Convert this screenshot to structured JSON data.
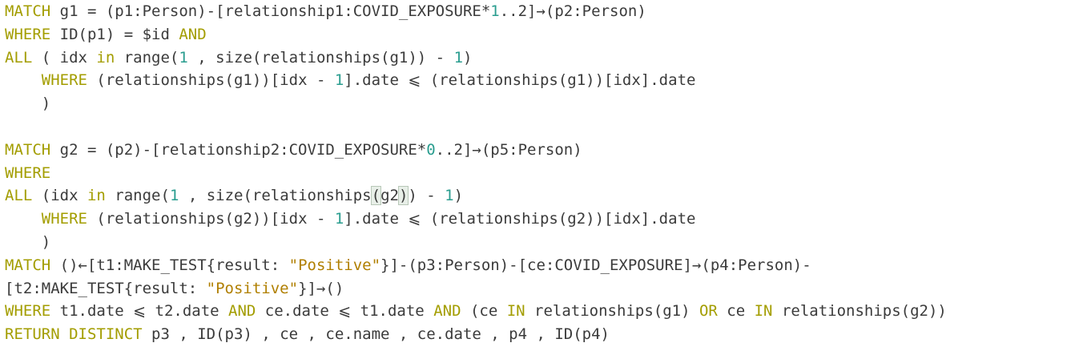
{
  "colors": {
    "background": "#ffffff",
    "text": "#3b3b3b",
    "keyword": "#a39d00",
    "number": "#2a9d8f",
    "string": "#b07f00"
  },
  "code": {
    "lines": [
      [
        {
          "t": "MATCH",
          "c": "kw"
        },
        {
          "t": " g1 = (p1:Person)-[relationship1:COVID_EXPOSURE*"
        },
        {
          "t": "1",
          "c": "num"
        },
        {
          "t": "..2]→(p2:Person)"
        }
      ],
      [
        {
          "t": "WHERE",
          "c": "kw"
        },
        {
          "t": " ID(p1) = $id "
        },
        {
          "t": "AND",
          "c": "kw"
        }
      ],
      [
        {
          "t": "ALL",
          "c": "kw"
        },
        {
          "t": " ( idx "
        },
        {
          "t": "in",
          "c": "kw"
        },
        {
          "t": " range("
        },
        {
          "t": "1",
          "c": "num"
        },
        {
          "t": " , size(relationships(g1)) - "
        },
        {
          "t": "1",
          "c": "num"
        },
        {
          "t": ")"
        }
      ],
      [
        {
          "t": "    "
        },
        {
          "t": "WHERE",
          "c": "kw"
        },
        {
          "t": " (relationships(g1))[idx - "
        },
        {
          "t": "1",
          "c": "num"
        },
        {
          "t": "].date ⩽ (relationships(g1))[idx].date"
        }
      ],
      [
        {
          "t": "    )"
        }
      ],
      [
        {
          "t": ""
        }
      ],
      [
        {
          "t": "MATCH",
          "c": "kw"
        },
        {
          "t": " g2 = (p2)-[relationship2:COVID_EXPOSURE*"
        },
        {
          "t": "0",
          "c": "num"
        },
        {
          "t": "..2]→(p5:Person)"
        }
      ],
      [
        {
          "t": "WHERE",
          "c": "kw"
        }
      ],
      [
        {
          "t": "ALL",
          "c": "kw"
        },
        {
          "t": " (idx "
        },
        {
          "t": "in",
          "c": "kw"
        },
        {
          "t": " range("
        },
        {
          "t": "1",
          "c": "num"
        },
        {
          "t": " , size(relationships"
        },
        {
          "t": "(",
          "c": "hl"
        },
        {
          "t": "g2"
        },
        {
          "t": ")",
          "c": "hl"
        },
        {
          "t": ") - "
        },
        {
          "t": "1",
          "c": "num"
        },
        {
          "t": ")"
        }
      ],
      [
        {
          "t": "    "
        },
        {
          "t": "WHERE",
          "c": "kw"
        },
        {
          "t": " (relationships(g2))[idx - "
        },
        {
          "t": "1",
          "c": "num"
        },
        {
          "t": "].date ⩽ (relationships(g2))[idx].date"
        }
      ],
      [
        {
          "t": "    )"
        }
      ],
      [
        {
          "t": "MATCH",
          "c": "kw"
        },
        {
          "t": " ()←[t1:MAKE_TEST{result: "
        },
        {
          "t": "\"Positive\"",
          "c": "str"
        },
        {
          "t": "}]-(p3:Person)-[ce:COVID_EXPOSURE]→(p4:Person)-"
        }
      ],
      [
        {
          "t": "[t2:MAKE_TEST{result: "
        },
        {
          "t": "\"Positive\"",
          "c": "str"
        },
        {
          "t": "}]→()"
        }
      ],
      [
        {
          "t": "WHERE",
          "c": "kw"
        },
        {
          "t": " t1.date ⩽ t2.date "
        },
        {
          "t": "AND",
          "c": "kw"
        },
        {
          "t": " ce.date ⩽ t1.date "
        },
        {
          "t": "AND",
          "c": "kw"
        },
        {
          "t": " (ce "
        },
        {
          "t": "IN",
          "c": "kw"
        },
        {
          "t": " relationships(g1) "
        },
        {
          "t": "OR",
          "c": "kw"
        },
        {
          "t": " ce "
        },
        {
          "t": "IN",
          "c": "kw"
        },
        {
          "t": " relationships(g2))"
        }
      ],
      [
        {
          "t": "RETURN",
          "c": "kw"
        },
        {
          "t": " "
        },
        {
          "t": "DISTINCT",
          "c": "kw"
        },
        {
          "t": " p3 , ID(p3) , ce , ce.name , ce.date , p4 , ID(p4)"
        }
      ]
    ]
  }
}
